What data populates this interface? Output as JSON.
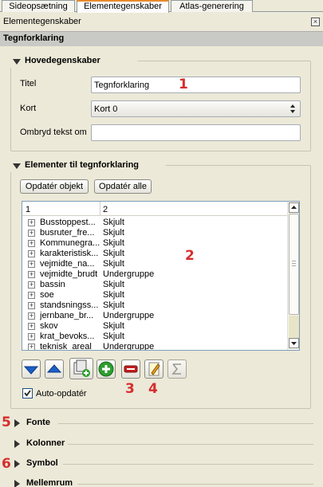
{
  "tabs": [
    "Sideopsætning",
    "Elementegenskaber",
    "Atlas-generering"
  ],
  "dock_title": "Elementegenskaber",
  "header_title": "Tegnforklaring",
  "main_props": {
    "title": "Hovedegenskaber",
    "titel_label": "Titel",
    "titel_value": "Tegnforklaring",
    "kort_label": "Kort",
    "kort_value": "Kort 0",
    "wrap_label": "Ombryd tekst om",
    "wrap_value": ""
  },
  "legend_items": {
    "title": "Elementer til tegnforklaring",
    "update_item_btn": "Opdatér objekt",
    "update_all_btn": "Opdatér alle",
    "columns": [
      "1",
      "2"
    ],
    "rows": [
      {
        "name": "Busstoppest...",
        "value": "Skjult"
      },
      {
        "name": "busruter_fre...",
        "value": "Skjult"
      },
      {
        "name": "Kommunegra...",
        "value": "Skjult"
      },
      {
        "name": "karakteristisk...",
        "value": "Skjult"
      },
      {
        "name": "vejmidte_na...",
        "value": "Skjult"
      },
      {
        "name": "vejmidte_brudt",
        "value": "Undergruppe"
      },
      {
        "name": "bassin",
        "value": "Skjult"
      },
      {
        "name": "soe",
        "value": "Skjult"
      },
      {
        "name": "standsningss...",
        "value": "Skjult"
      },
      {
        "name": "jernbane_br...",
        "value": "Undergruppe"
      },
      {
        "name": "skov",
        "value": "Skjult"
      },
      {
        "name": "krat_bevoks...",
        "value": "Skjult"
      },
      {
        "name": "teknisk_areal",
        "value": "Undergruppe"
      }
    ],
    "auto_update_label": "Auto-opdatér",
    "auto_update_checked": true
  },
  "sections": [
    "Fonte",
    "Kolonner",
    "Symbol",
    "Mellemrum"
  ],
  "annotations": [
    "1",
    "2",
    "3",
    "4",
    "5",
    "6"
  ],
  "colors": {
    "annotation": "#d62e2e",
    "active_tab_accent": "#e68b2c"
  }
}
